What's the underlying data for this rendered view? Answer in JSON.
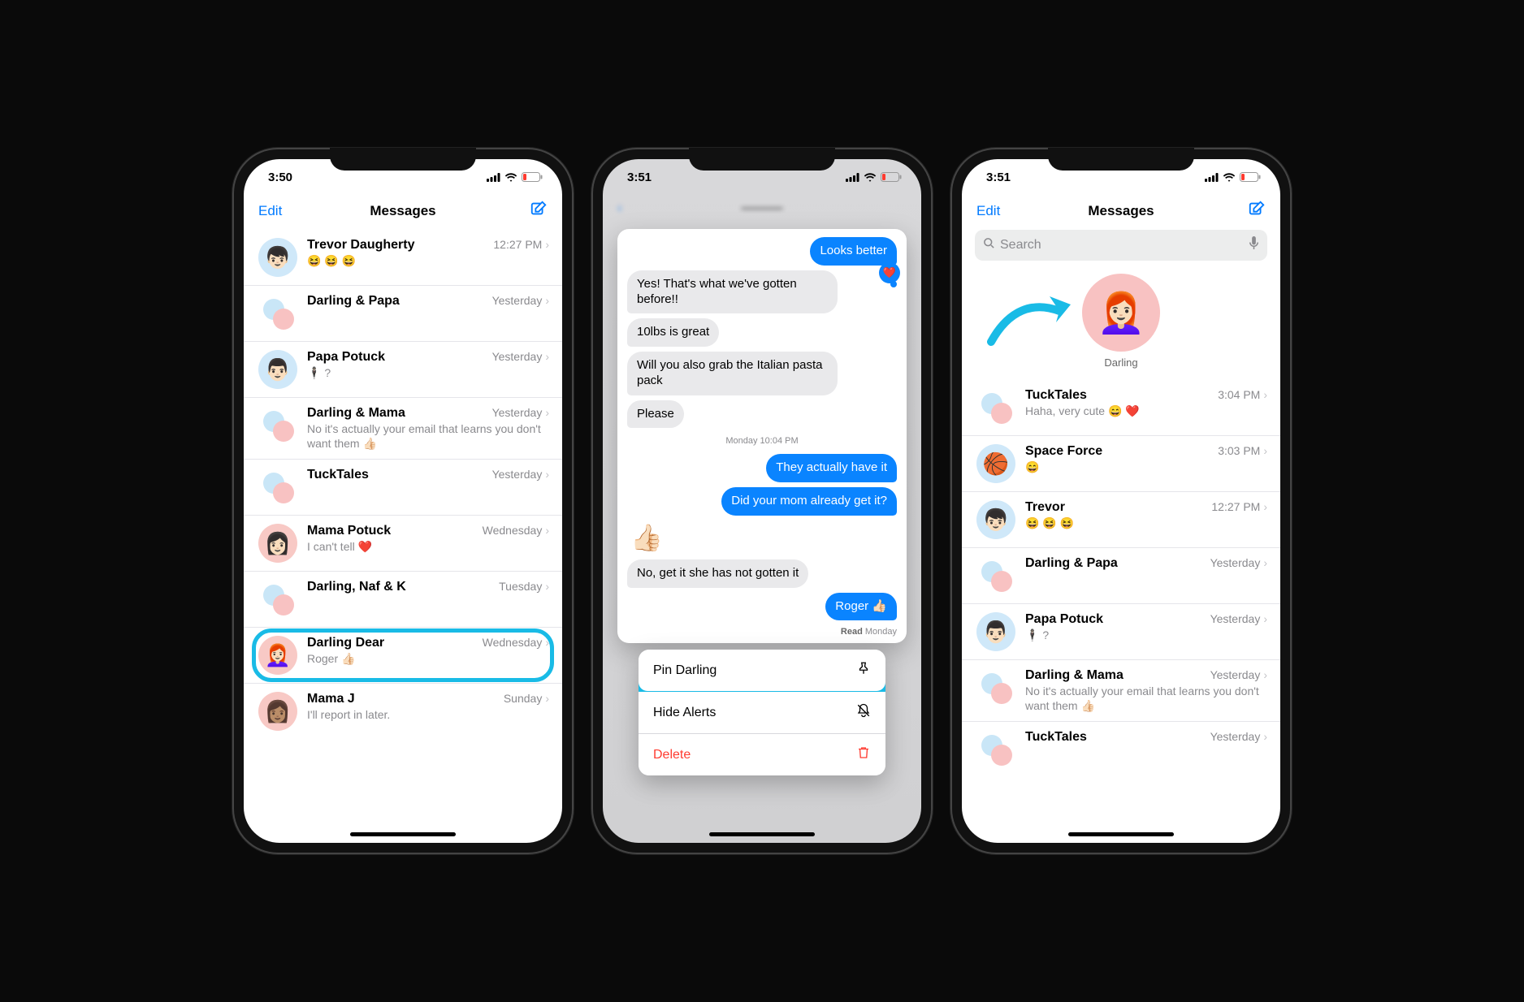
{
  "annotation_color": "#19bbe6",
  "phone1": {
    "time": "3:50",
    "nav": {
      "edit": "Edit",
      "title": "Messages"
    },
    "conversations": [
      {
        "name": "Trevor Daugherty",
        "time": "12:27 PM",
        "preview": "😆 😆 😆",
        "avatar_type": "blue",
        "emoji": "👦🏻"
      },
      {
        "name": "Darling & Papa",
        "time": "Yesterday",
        "preview": "",
        "avatar_type": "multi"
      },
      {
        "name": "Papa Potuck",
        "time": "Yesterday",
        "preview": "🕴🏻 ?",
        "avatar_type": "blue",
        "emoji": "👨🏻"
      },
      {
        "name": "Darling & Mama",
        "time": "Yesterday",
        "preview": "No it's actually your email that learns you don't want them 👍🏻",
        "avatar_type": "multi"
      },
      {
        "name": "TuckTales",
        "time": "Yesterday",
        "preview": "",
        "avatar_type": "multi"
      },
      {
        "name": "Mama Potuck",
        "time": "Wednesday",
        "preview": "I can't tell ❤️",
        "avatar_type": "pink",
        "emoji": "👩🏻"
      },
      {
        "name": "Darling, Naf & K",
        "time": "Tuesday",
        "preview": "",
        "avatar_type": "multi"
      },
      {
        "name": "Darling Dear",
        "time": "Wednesday",
        "preview": "Roger 👍🏻",
        "avatar_type": "pink",
        "emoji": "👩🏻‍🦰",
        "highlighted": true
      },
      {
        "name": "Mama J",
        "time": "Sunday",
        "preview": "I'll report in later.",
        "avatar_type": "pink",
        "emoji": "👩🏽"
      }
    ]
  },
  "phone2": {
    "time": "3:51",
    "preview_thread": {
      "top_me": "Looks better",
      "tapback_emoji": "❤️",
      "them": [
        "Yes! That's what we've gotten before!!",
        "10lbs is great",
        "Will you also grab the Italian pasta pack",
        "Please"
      ],
      "timestamp": "Monday 10:04 PM",
      "me": [
        "They actually have it",
        "Did your mom already get it?"
      ],
      "thumbs": "👍🏻",
      "them2": "No, get it she has not gotten it",
      "me2": "Roger 👍🏻",
      "read_label": "Read",
      "read_time": "Monday"
    },
    "context_menu": [
      {
        "label": "Pin Darling",
        "icon": "pin",
        "highlighted": true
      },
      {
        "label": "Hide Alerts",
        "icon": "bell-slash"
      },
      {
        "label": "Delete",
        "icon": "trash",
        "destructive": true
      }
    ]
  },
  "phone3": {
    "time": "3:51",
    "nav": {
      "edit": "Edit",
      "title": "Messages"
    },
    "search_placeholder": "Search",
    "pinned": {
      "name": "Darling",
      "emoji": "👩🏻‍🦰"
    },
    "conversations": [
      {
        "name": "TuckTales",
        "time": "3:04 PM",
        "preview": "Haha, very cute 😄 ❤️",
        "avatar_type": "multi"
      },
      {
        "name": "Space Force",
        "time": "3:03 PM",
        "preview": "😄",
        "avatar_type": "blue",
        "emoji": "🏀"
      },
      {
        "name": "Trevor",
        "time": "12:27 PM",
        "preview": "😆 😆 😆",
        "avatar_type": "blue",
        "emoji": "👦🏻"
      },
      {
        "name": "Darling & Papa",
        "time": "Yesterday",
        "preview": "",
        "avatar_type": "multi"
      },
      {
        "name": "Papa Potuck",
        "time": "Yesterday",
        "preview": "🕴🏻 ?",
        "avatar_type": "blue",
        "emoji": "👨🏻"
      },
      {
        "name": "Darling & Mama",
        "time": "Yesterday",
        "preview": "No it's actually your email that learns you don't want them 👍🏻",
        "avatar_type": "multi"
      },
      {
        "name": "TuckTales",
        "time": "Yesterday",
        "preview": "",
        "avatar_type": "multi"
      }
    ]
  }
}
